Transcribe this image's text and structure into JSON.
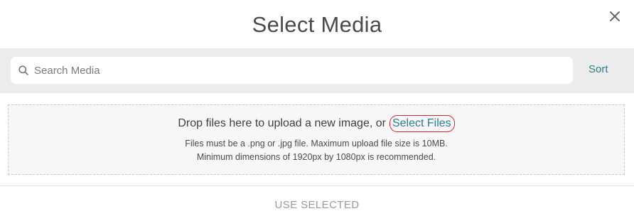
{
  "modal": {
    "title": "Select Media",
    "close_icon": "close-icon"
  },
  "toolbar": {
    "search": {
      "placeholder": "Search Media",
      "value": "",
      "icon": "search-icon"
    },
    "sort_label": "Sort"
  },
  "dropzone": {
    "prompt": "Drop files here to upload a new image, or",
    "select_files_label": "Select Files",
    "hint_line1": "Files must be a .png or .jpg file. Maximum upload file size is 10MB.",
    "hint_line2": "Minimum dimensions of 1920px by 1080px is recommended."
  },
  "footer": {
    "use_selected_label": "USE SELECTED"
  },
  "colors": {
    "accent": "#2a7d8c",
    "highlight_ring": "#d8262e",
    "toolbar_bg": "#ececec",
    "disabled_text": "#9a9a9a"
  }
}
